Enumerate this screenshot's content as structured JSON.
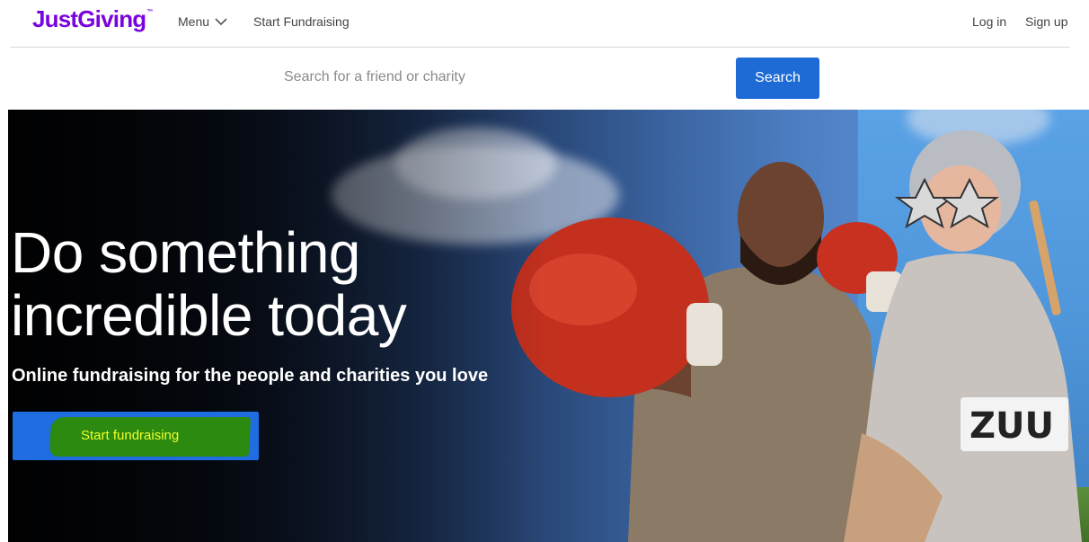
{
  "header": {
    "logo_text": "JustGiving",
    "logo_tm": "™",
    "menu_label": "Menu",
    "start_fundraising_link": "Start Fundraising",
    "login_label": "Log in",
    "signup_label": "Sign up",
    "brand_color": "#7a04dd"
  },
  "search": {
    "placeholder": "Search for a friend or charity",
    "value": "",
    "button_label": "Search",
    "button_color": "#1e6bd6"
  },
  "hero": {
    "title_line1": "Do something",
    "title_line2": "incredible today",
    "subtitle": "Online fundraising for the people and charities you love",
    "cta_label": "Start fundraising",
    "cta_color": "#1f6de0",
    "cta_highlight_color": "#2b8a0f",
    "cta_label_color": "#f0ff2a"
  }
}
